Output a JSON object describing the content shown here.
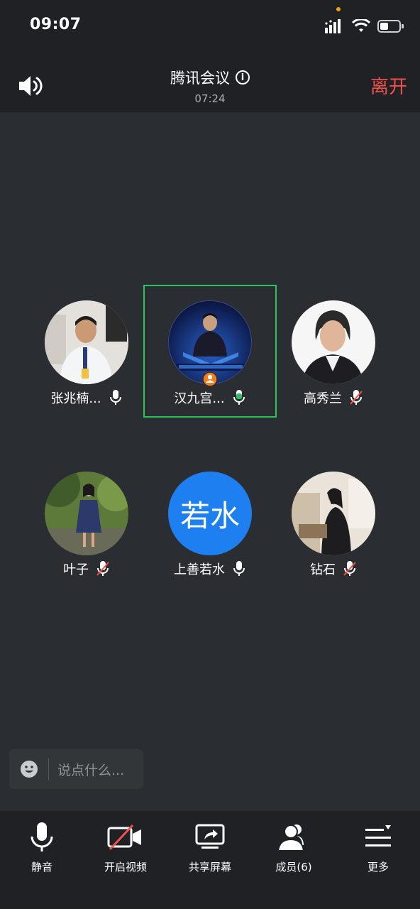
{
  "status": {
    "time": "09:07"
  },
  "header": {
    "title": "腾讯会议",
    "duration": "07:24",
    "leave_label": "离开"
  },
  "participants": [
    {
      "name": "张兆楠...",
      "mic": "on",
      "avatar": "photo"
    },
    {
      "name": "汉九宫...",
      "mic": "speaking",
      "avatar": "photo",
      "host": true,
      "active_speaker": true
    },
    {
      "name": "高秀兰",
      "mic": "muted",
      "avatar": "photo"
    },
    {
      "name": "叶子",
      "mic": "muted",
      "avatar": "photo"
    },
    {
      "name": "上善若水",
      "mic": "on",
      "avatar": "text",
      "avatar_text": "若水"
    },
    {
      "name": "钻石",
      "mic": "muted",
      "avatar": "photo"
    }
  ],
  "chat": {
    "placeholder": "说点什么..."
  },
  "toolbar": {
    "mute_label": "静音",
    "video_label": "开启视频",
    "share_label": "共享屏幕",
    "members_label": "成员(6)",
    "more_label": "更多"
  },
  "colors": {
    "accent_green": "#2dc25d",
    "leave_red": "#f0514d",
    "avatar_blue": "#1e80f0"
  }
}
